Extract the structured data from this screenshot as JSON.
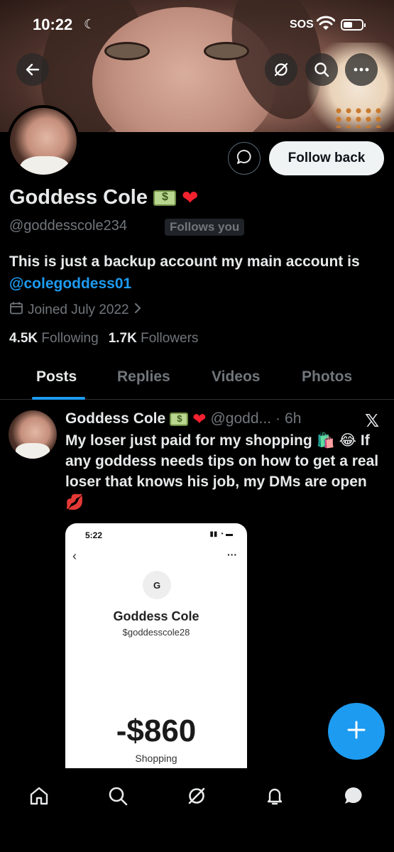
{
  "status_bar": {
    "time": "10:22",
    "carrier": "SOS"
  },
  "profile": {
    "display_name": "Goddess Cole",
    "handle": "@goddesscole234",
    "follows_you": "Follows you",
    "bio_prefix": "This is just a backup account my main account is ",
    "bio_mention": "@colegoddess01",
    "joined": "Joined July 2022",
    "following_count": "4.5K",
    "following_label": "Following",
    "followers_count": "1.7K",
    "followers_label": "Followers",
    "follow_button": "Follow back"
  },
  "tabs": [
    {
      "label": "Posts",
      "active": true
    },
    {
      "label": "Replies",
      "active": false
    },
    {
      "label": "Videos",
      "active": false
    },
    {
      "label": "Photos",
      "active": false
    }
  ],
  "post": {
    "author": "Goddess Cole",
    "handle": "@godd...",
    "separator": "·",
    "time": "6h",
    "text": "My loser just paid for my shopping 🛍️ 😂 If any goddess needs tips on how to get a real loser that knows his job, my DMs are open 💋",
    "embed": {
      "time": "5:22",
      "initial": "G",
      "name": "Goddess Cole",
      "cashtag": "$goddesscole28",
      "amount": "-$860",
      "note": "Shopping"
    }
  },
  "icons": [
    "back-arrow-icon",
    "grok-icon",
    "search-icon",
    "more-icon",
    "message-icon",
    "calendar-icon",
    "chevron-right-icon",
    "x-logo-icon",
    "compose-plus-icon",
    "home-icon",
    "notifications-bell-icon",
    "messages-icon"
  ],
  "colors": {
    "accent": "#1d9bf0",
    "heart": "#f4212e",
    "muted": "#71767b",
    "text": "#e7e9ea"
  }
}
